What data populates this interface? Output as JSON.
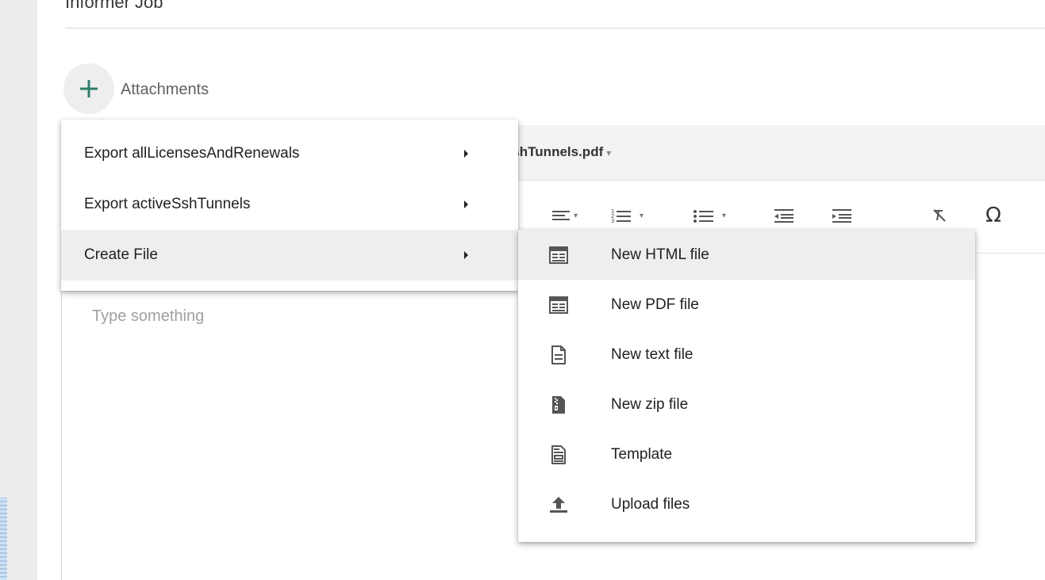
{
  "form": {
    "title_value": "Informer Job"
  },
  "attachments": {
    "add_icon": "plus-icon",
    "label": "Attachments",
    "accent_color": "#2e7d6b"
  },
  "file_tab": {
    "label": "SshTunnels.pdf",
    "caret": "▾"
  },
  "toolbar": {
    "omega": "Ω"
  },
  "editor": {
    "placeholder": "Type something"
  },
  "context_menu": {
    "items": [
      {
        "label": "Export allLicensesAndRenewals",
        "has_submenu": true
      },
      {
        "label": "Export activeSshTunnels",
        "has_submenu": true
      },
      {
        "label": "Create File",
        "has_submenu": true,
        "active": true
      }
    ]
  },
  "submenu": {
    "items": [
      {
        "label": "New HTML file",
        "icon": "html-file-icon",
        "active": true
      },
      {
        "label": "New PDF file",
        "icon": "pdf-file-icon"
      },
      {
        "label": "New text file",
        "icon": "text-file-icon"
      },
      {
        "label": "New zip file",
        "icon": "zip-file-icon"
      },
      {
        "label": "Template",
        "icon": "template-icon"
      },
      {
        "label": "Upload files",
        "icon": "upload-icon"
      }
    ]
  }
}
